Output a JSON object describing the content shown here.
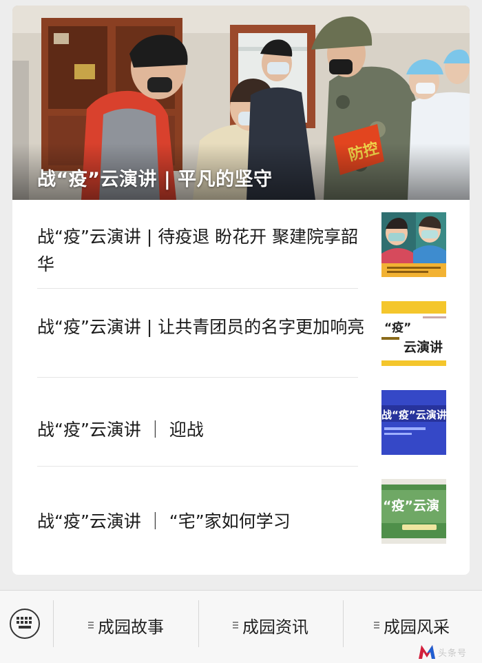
{
  "hero": {
    "title": "战“疫”云演讲 | 平凡的坚守",
    "armband_text": "防控"
  },
  "articles": [
    {
      "title": "战“疫”云演讲 | 待疫退 盼花开 聚建院享韶华",
      "thumb_icon": "masked-figures-illustration-thumbnail"
    },
    {
      "title": "战“疫”云演讲 | 让共青团员的名字更加响亮",
      "thumb_icon": "yellow-poster-thumbnail",
      "thumb_text_1": "“疫”",
      "thumb_text_2": "云演讲"
    },
    {
      "title": "战“疫”云演讲 ｜ 迎战",
      "thumb_icon": "blue-poster-thumbnail",
      "thumb_text": "战“疫”云演讲"
    },
    {
      "title": "战“疫”云演讲 ｜ “宅”家如何学习",
      "thumb_icon": "green-poster-thumbnail",
      "thumb_text": "“疫”云演"
    }
  ],
  "tabbar": {
    "keyboard_icon": "keyboard-icon",
    "tabs": [
      {
        "label": "成园故事"
      },
      {
        "label": "成园资讯"
      },
      {
        "label": "成园风采"
      }
    ]
  },
  "watermark": {
    "text": "头条号"
  }
}
